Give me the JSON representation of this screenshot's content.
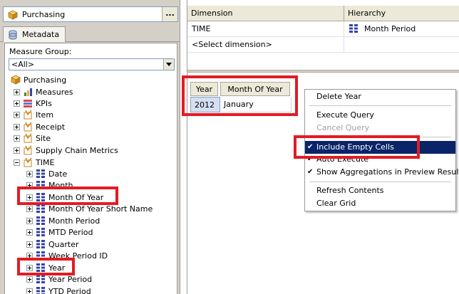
{
  "cube_selector": {
    "value": "Purchasing",
    "browse_label": "..."
  },
  "tabs": [
    {
      "label": "Metadata"
    }
  ],
  "measure_group": {
    "label": "Measure Group:",
    "value": "<All>"
  },
  "tree": {
    "root": "Purchasing",
    "items": [
      {
        "label": "Measures",
        "icon": "measures-icon"
      },
      {
        "label": "KPIs",
        "icon": "kpis-icon"
      },
      {
        "label": "Item",
        "icon": "dimension-icon"
      },
      {
        "label": "Receipt",
        "icon": "dimension-icon"
      },
      {
        "label": "Site",
        "icon": "dimension-icon"
      },
      {
        "label": "Supply Chain Metrics",
        "icon": "dimension-icon"
      },
      {
        "label": "TIME",
        "icon": "dimension-icon"
      }
    ],
    "time_children": [
      "Date",
      "Month",
      "Month Of Year",
      "Month Of Year Short Name",
      "Month Period",
      "MTD Period",
      "Quarter",
      "Week Period ID",
      "Year",
      "Year Period",
      "YTD Period"
    ]
  },
  "filter_grid": {
    "headers": [
      "Dimension",
      "Hierarchy"
    ],
    "rows": [
      {
        "dimension": "TIME",
        "hierarchy": "Month Period"
      },
      {
        "dimension": "<Select dimension>",
        "hierarchy": ""
      }
    ]
  },
  "result_grid": {
    "headers": [
      "Year",
      "Month Of Year"
    ],
    "row": [
      "2012",
      "January"
    ]
  },
  "context_menu": {
    "items": [
      {
        "label": "Delete Year",
        "checked": false,
        "disabled": false
      },
      {
        "label": "Execute Query",
        "checked": false,
        "disabled": false
      },
      {
        "label": "Cancel Query",
        "checked": false,
        "disabled": true
      },
      {
        "label": "Include Empty Cells",
        "checked": true,
        "disabled": false,
        "selected": true
      },
      {
        "label": "Auto Execute",
        "checked": true,
        "disabled": false
      },
      {
        "label": "Show Aggregations in Preview Results",
        "checked": true,
        "disabled": false
      },
      {
        "label": "Refresh Contents",
        "checked": false,
        "disabled": false
      },
      {
        "label": "Clear Grid",
        "checked": false,
        "disabled": false
      }
    ]
  },
  "colors": {
    "highlight": "#e31b23",
    "menu_selection": "#0a246a",
    "hierarchy_icon": "#3344aa",
    "cube_icon": "#e8a93a"
  }
}
